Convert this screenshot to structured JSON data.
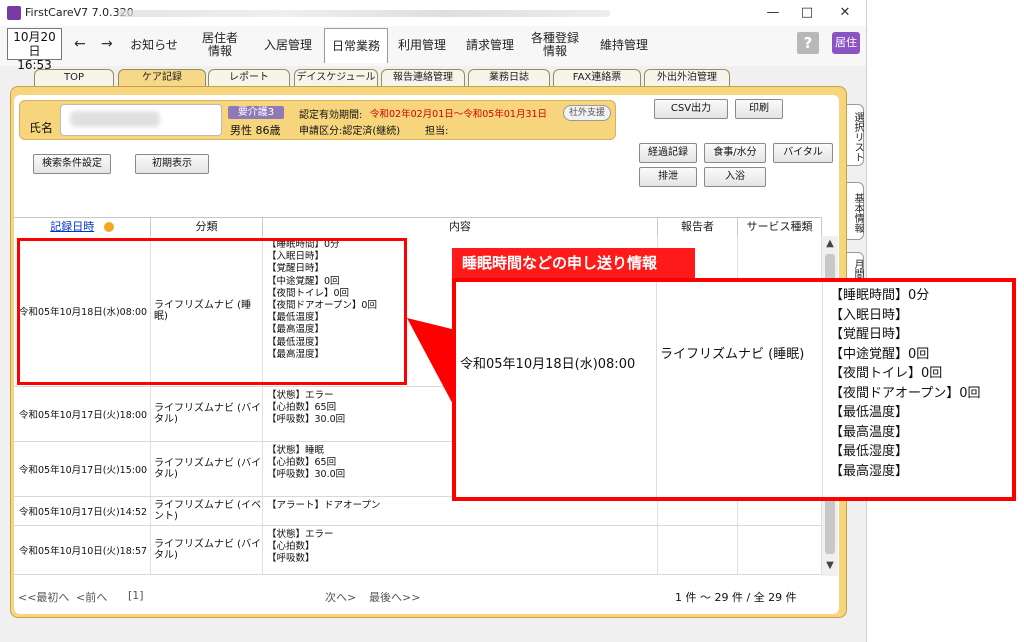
{
  "app": {
    "title": "FirstCareV7 7.0.320"
  },
  "window_controls": {
    "minimize": "—",
    "maximize": "□",
    "close": "✕"
  },
  "date_box": {
    "date": "10月20日",
    "time": "16:53"
  },
  "nav": {
    "back": "←",
    "forward": "→"
  },
  "menu": [
    {
      "label": "お知らせ"
    },
    {
      "label": "居住者\n情報"
    },
    {
      "label": "入居管理"
    },
    {
      "label": "日常業務",
      "active": true
    },
    {
      "label": "利用管理"
    },
    {
      "label": "請求管理"
    },
    {
      "label": "各種登録\n情報"
    },
    {
      "label": "維持管理"
    }
  ],
  "help_label": "?",
  "kyo_label": "居住",
  "subtabs": [
    {
      "label": "TOP"
    },
    {
      "label": "ケア記録",
      "active": true
    },
    {
      "label": "レポート"
    },
    {
      "label": "デイスケジュール"
    },
    {
      "label": "報告連絡管理"
    },
    {
      "label": "業務日誌"
    },
    {
      "label": "FAX連絡票"
    },
    {
      "label": "外出外泊管理"
    }
  ],
  "resident": {
    "name_label": "氏名",
    "care_level": "要介護3",
    "gender_age": "男性 86歳",
    "validity_label": "認定有効期間:",
    "validity_value": "令和02年02月01日～令和05年01月31日",
    "application_label": "申請区分:認定済(継続)",
    "staff_label": "担当:",
    "shagai_label": "社外支援"
  },
  "buttons": {
    "csv": "CSV出力",
    "print": "印刷",
    "search_settings": "検索条件設定",
    "initial_display": "初期表示",
    "progress": "経過記録",
    "meal": "食事/水分",
    "vital": "バイタル",
    "excretion": "排泄",
    "bath": "入浴"
  },
  "table": {
    "headers": {
      "datetime": "記録日時",
      "category": "分類",
      "content": "内容",
      "reporter": "報告者",
      "service": "サービス種類"
    },
    "rows": [
      {
        "datetime": "令和05年10月18日(水)08:00",
        "category": "ライフリズムナビ (睡眠)",
        "content": [
          "【睡眠時間】0分",
          "【入眠日時】",
          "【覚醒日時】",
          "【中途覚醒】0回",
          "【夜間トイレ】0回",
          "【夜間ドアオープン】0回",
          "【最低温度】",
          "【最高温度】",
          "【最低湿度】",
          "【最高湿度】"
        ]
      },
      {
        "datetime": "令和05年10月17日(火)18:00",
        "category": "ライフリズムナビ (バイタル)",
        "content": [
          "【状態】エラー",
          "【心拍数】65回",
          "【呼吸数】30.0回"
        ]
      },
      {
        "datetime": "令和05年10月17日(火)15:00",
        "category": "ライフリズムナビ (バイタル)",
        "content": [
          "【状態】睡眠",
          "【心拍数】65回",
          "【呼吸数】30.0回"
        ]
      },
      {
        "datetime": "令和05年10月17日(火)14:52",
        "category": "ライフリズムナビ (イベント)",
        "content": [
          "【アラート】ドアオープン"
        ]
      },
      {
        "datetime": "令和05年10月10日(火)18:57",
        "category": "ライフリズムナビ (バイタル)",
        "content": [
          "【状態】エラー",
          "【心拍数】",
          "【呼吸数】"
        ]
      }
    ]
  },
  "pagination": {
    "first": "<<最初へ",
    "prev": "<前へ",
    "page": "[1]",
    "next": "次へ>",
    "last": "最後へ>>",
    "summary": "1 件 ～ 29 件 / 全 29 件"
  },
  "side_tabs": {
    "select_list": "選択リスト",
    "basic_info": "基本情報",
    "monthly": "月間"
  },
  "callout": {
    "title": "睡眠時間などの申し送り情報",
    "datetime": "令和05年10月18日(水)08:00",
    "category": "ライフリズムナビ (睡眠)",
    "content": [
      "【睡眠時間】0分",
      "【入眠日時】",
      "【覚醒日時】",
      "【中途覚醒】0回",
      "【夜間トイレ】0回",
      "【夜間ドアオープン】0回",
      "【最低温度】",
      "【最高温度】",
      "【最低湿度】",
      "【最高湿度】"
    ]
  },
  "colors": {
    "panel": "#f6d57c",
    "highlight": "#ff0000",
    "care_badge": "#8f7ab6",
    "kyo": "#8a55c2"
  }
}
